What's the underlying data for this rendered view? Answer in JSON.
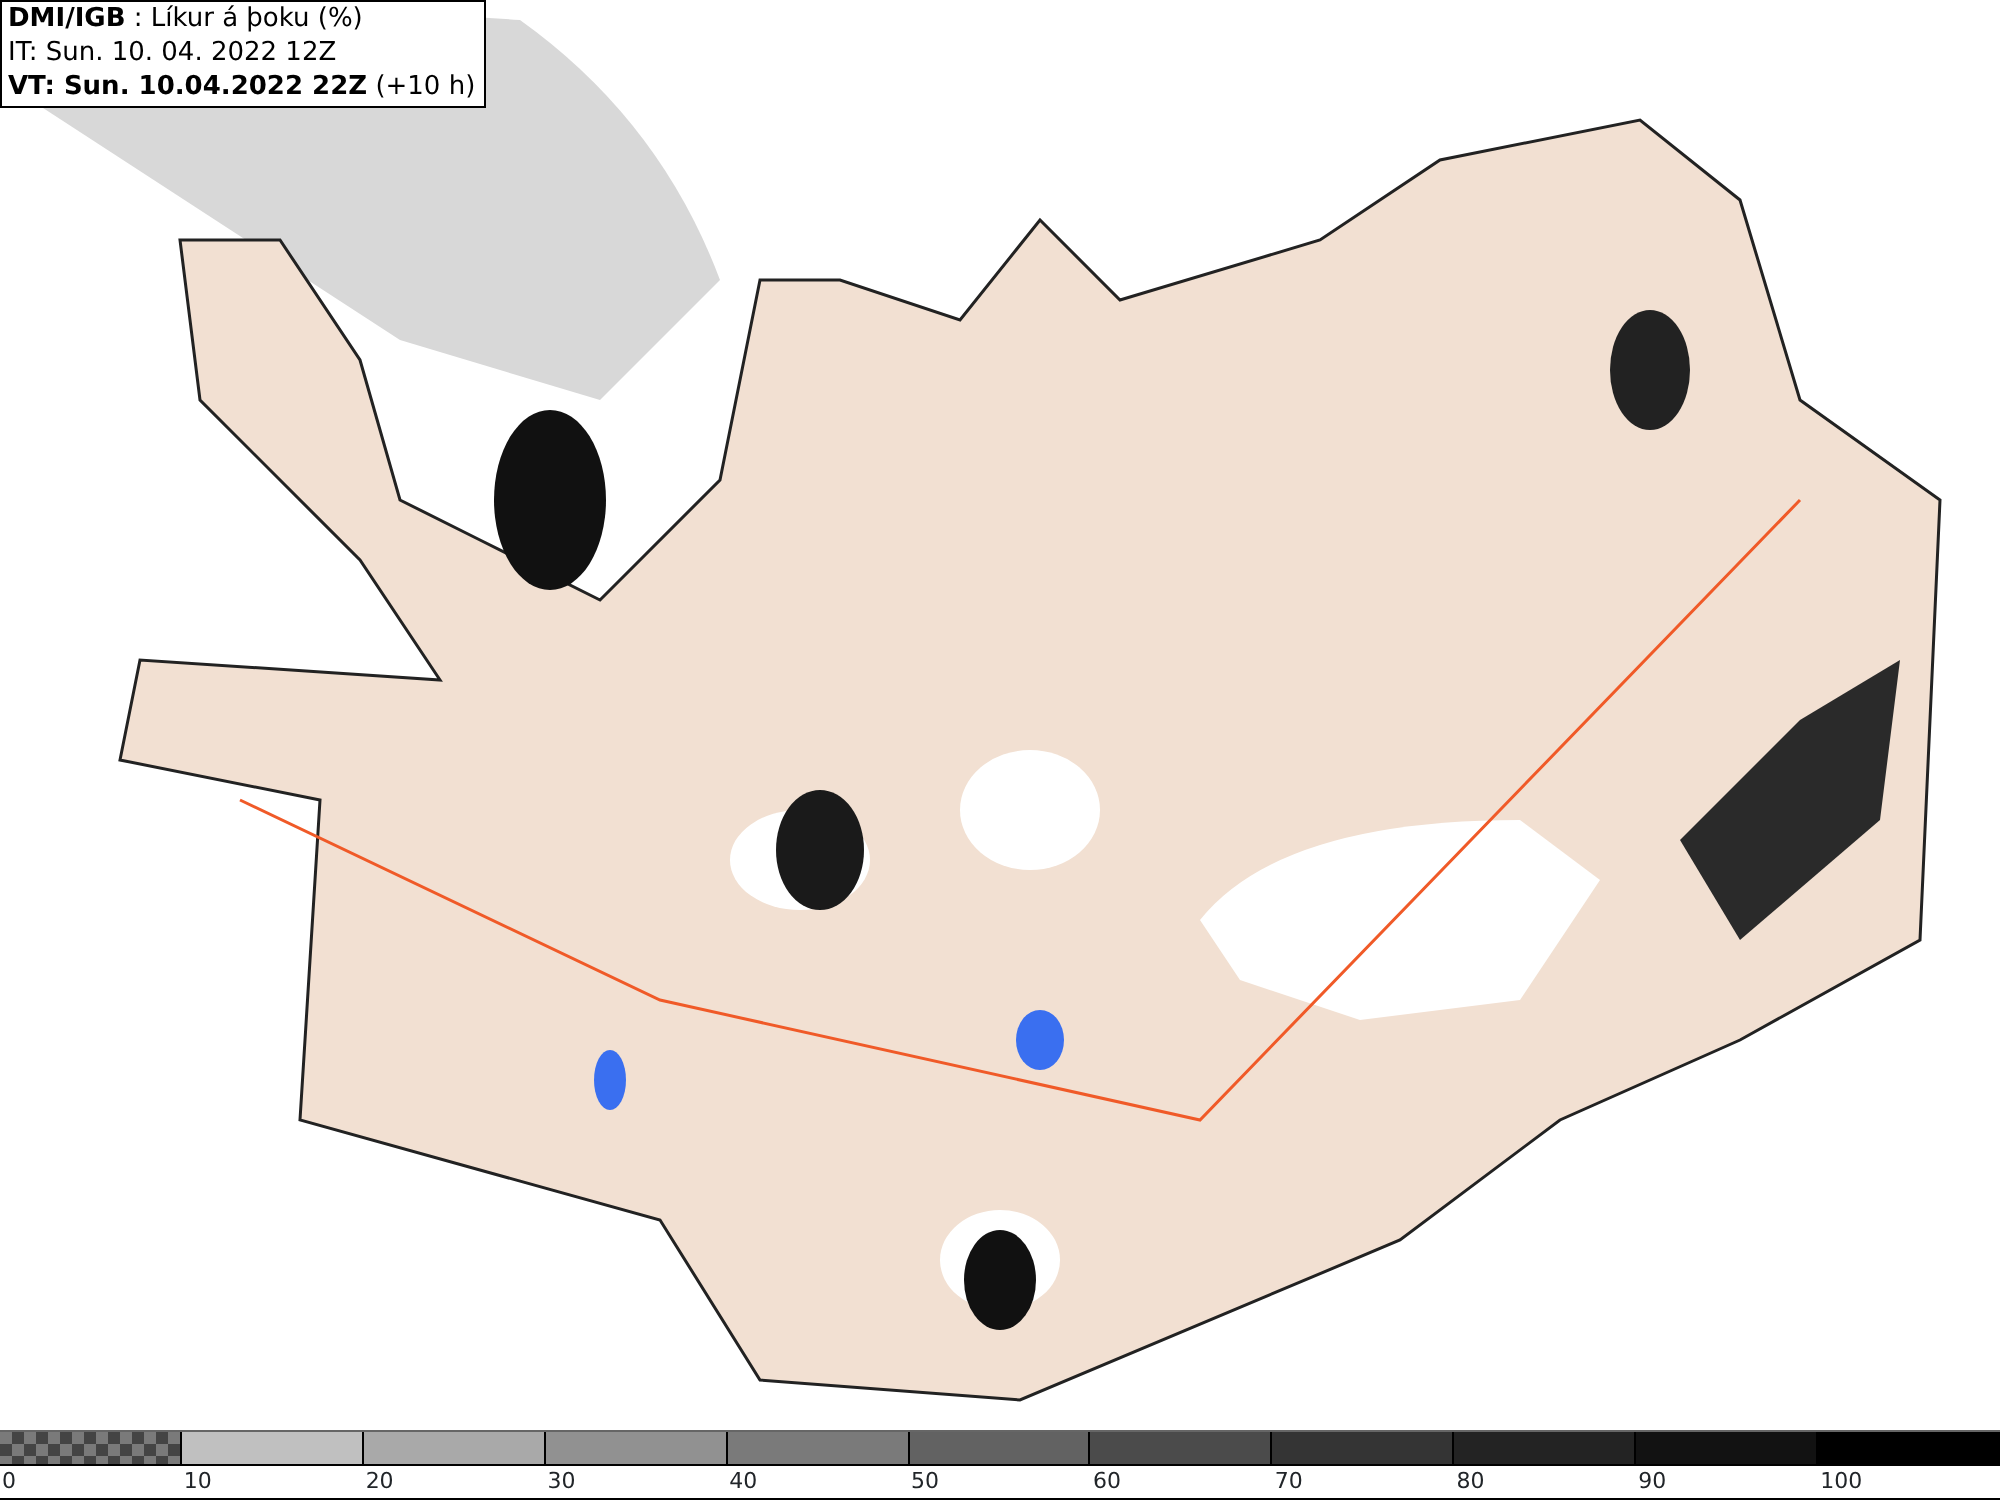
{
  "title_box": {
    "lines": [
      "**DMI/IGB** : Líkur á þoku (%)",
      "IT: Sun. 10. 04. 2022 12Z",
      "**VT: Sun. 10.04.2022 22Z** (+10 h)"
    ]
  },
  "legend": {
    "bins": [
      {
        "kind": "checkered",
        "color": "#7a7a7a"
      },
      {
        "kind": "solid",
        "color": "#c0c0c0"
      },
      {
        "kind": "solid",
        "color": "#a9a9a9"
      },
      {
        "kind": "solid",
        "color": "#919191"
      },
      {
        "kind": "solid",
        "color": "#7a7a7a"
      },
      {
        "kind": "solid",
        "color": "#626262"
      },
      {
        "kind": "solid",
        "color": "#4b4b4b"
      },
      {
        "kind": "solid",
        "color": "#343434"
      },
      {
        "kind": "solid",
        "color": "#232323"
      },
      {
        "kind": "solid",
        "color": "#121212"
      },
      {
        "kind": "solid",
        "color": "#000000"
      }
    ],
    "ticks": [
      "0",
      "10",
      "20",
      "30",
      "40",
      "50",
      "60",
      "70",
      "80",
      "90",
      "100"
    ]
  }
}
